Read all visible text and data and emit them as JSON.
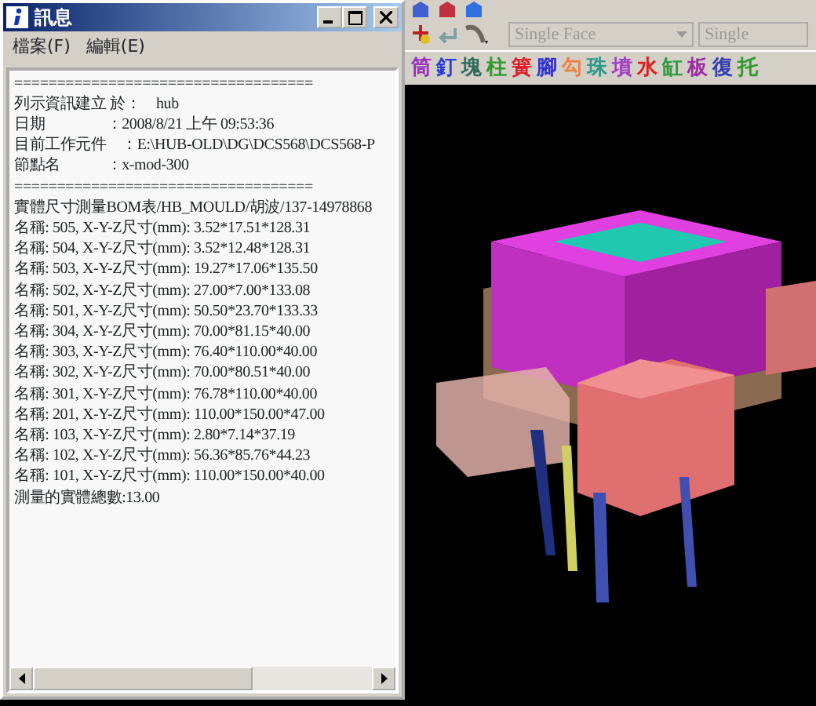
{
  "info_window": {
    "title": "訊息",
    "menu": [
      "檔案(F)",
      "編輯(E)"
    ],
    "lines": [
      "===================================",
      "列示資訊建立 於：　hub",
      "日期　　　　：2008/8/21 上午 09:53:36",
      "目前工作元件　：E:\\HUB-OLD\\DG\\DCS568\\DCS568-P",
      "節點名　　　：x-mod-300",
      "===================================",
      "實體尺寸測量BOM表/HB_MOULD/胡波/137-14978868",
      "名稱: 505,  X-Y-Z尺寸(mm): 3.52*17.51*128.31",
      "名稱: 504,  X-Y-Z尺寸(mm): 3.52*12.48*128.31",
      "名稱: 503,  X-Y-Z尺寸(mm): 19.27*17.06*135.50",
      "名稱: 502,  X-Y-Z尺寸(mm): 27.00*7.00*133.08",
      "名稱: 501,  X-Y-Z尺寸(mm): 50.50*23.70*133.33",
      "名稱: 304,  X-Y-Z尺寸(mm): 70.00*81.15*40.00",
      "名稱: 303,  X-Y-Z尺寸(mm): 76.40*110.00*40.00",
      "名稱: 302,  X-Y-Z尺寸(mm): 70.00*80.51*40.00",
      "名稱: 301,  X-Y-Z尺寸(mm): 76.78*110.00*40.00",
      "名稱: 201,  X-Y-Z尺寸(mm): 110.00*150.00*47.00",
      "名稱: 103,  X-Y-Z尺寸(mm): 2.80*7.14*37.19",
      "名稱: 102,  X-Y-Z尺寸(mm): 56.36*85.76*44.23",
      "名稱: 101,  X-Y-Z尺寸(mm): 110.00*150.00*40.00",
      "測量的實體總數:13.00"
    ]
  },
  "cad": {
    "dropdowns": [
      {
        "value": "Single Face"
      },
      {
        "value": "Single"
      }
    ],
    "palette": [
      {
        "label": "筒",
        "color": "#9a2fc0"
      },
      {
        "label": "釘",
        "color": "#2a3fd8"
      },
      {
        "label": "塊",
        "color": "#2f6a5a"
      },
      {
        "label": "柱",
        "color": "#2f9a2f"
      },
      {
        "label": "簧",
        "color": "#e0202a"
      },
      {
        "label": "腳",
        "color": "#3030d0"
      },
      {
        "label": "勾",
        "color": "#f08040"
      },
      {
        "label": "珠",
        "color": "#2f9a8a"
      },
      {
        "label": "墳",
        "color": "#a03fc0"
      },
      {
        "label": "水",
        "color": "#e02020"
      },
      {
        "label": "缸",
        "color": "#2f9a3f"
      },
      {
        "label": "板",
        "color": "#9a2fa0"
      },
      {
        "label": "復",
        "color": "#3040b0"
      },
      {
        "label": "托",
        "color": "#2f9a2f"
      }
    ]
  }
}
